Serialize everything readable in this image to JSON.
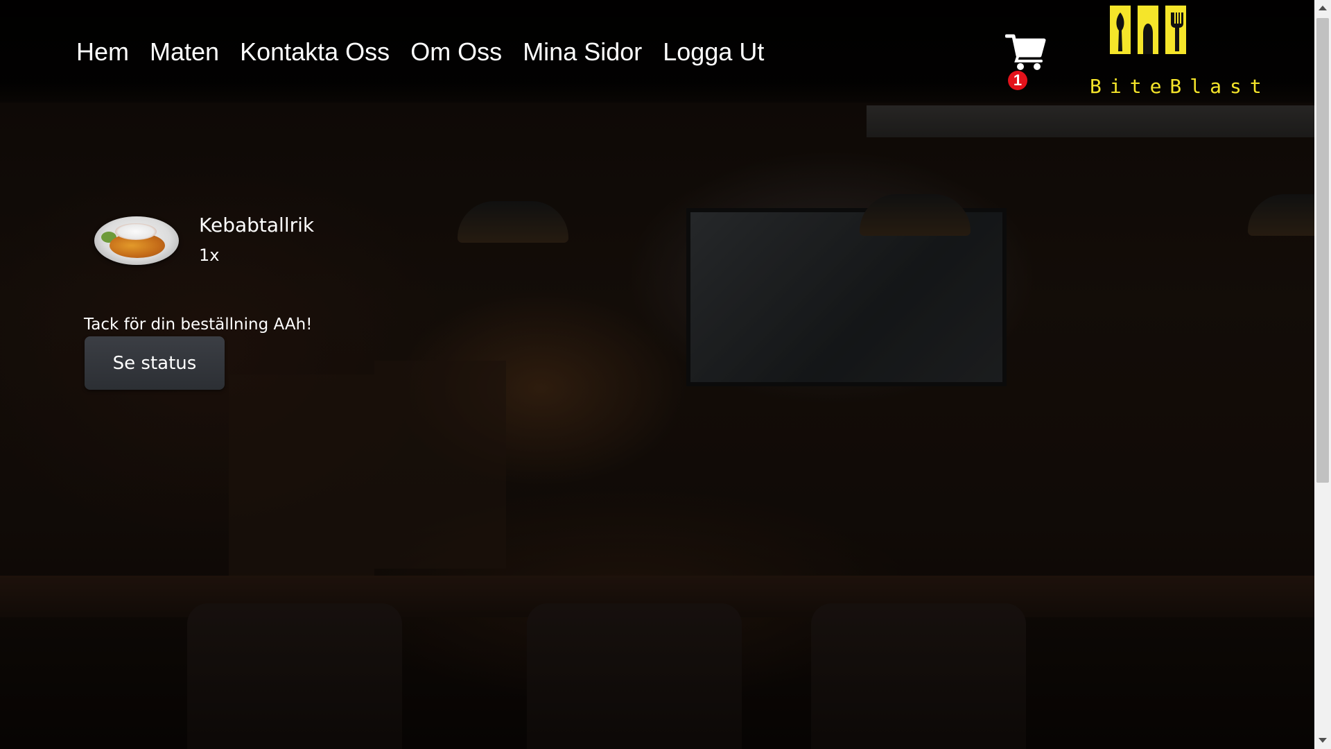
{
  "nav": {
    "items": [
      "Hem",
      "Maten",
      "Kontakta Oss",
      "Om Oss",
      "Mina Sidor",
      "Logga Ut"
    ]
  },
  "cart": {
    "icon": "cart-icon",
    "count": "1",
    "badge_color": "#e3121b"
  },
  "logo": {
    "text": "BiteBlast",
    "color": "#f5e52a"
  },
  "order": {
    "items": [
      {
        "name": "Kebabtallrik",
        "quantity": "1x",
        "image": "kebab-plate-image"
      }
    ],
    "thanks_message": "Tack för din beställning AAh!",
    "status_button": "Se status"
  }
}
